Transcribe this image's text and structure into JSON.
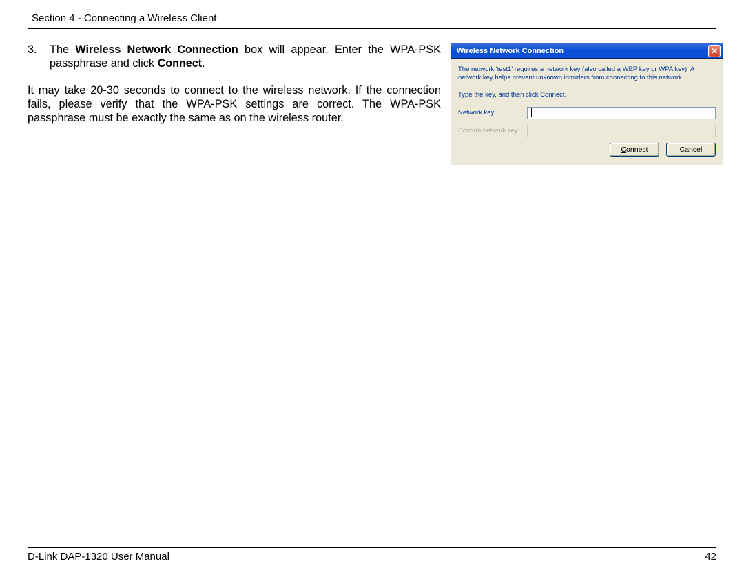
{
  "header": {
    "section": "Section 4 - Connecting a Wireless Client"
  },
  "step": {
    "num": "3.",
    "part1": "The ",
    "bold1": "Wireless Network Connection",
    "part2": " box will appear. Enter the WPA-PSK passphrase and click ",
    "bold2": "Connect",
    "part3": "."
  },
  "para2": "It may take 20-30 seconds to connect to the wireless network. If the connection fails, please verify that the WPA-PSK settings are correct. The WPA-PSK passphrase must be exactly the same as on the wireless router.",
  "dialog": {
    "title": "Wireless Network Connection",
    "intro": "The network 'test1' requires a network key (also called a WEP key or WPA key). A network key helps prevent unknown intruders from connecting to this network.",
    "instr": "Type the key, and then click Connect.",
    "label_key": "Network key:",
    "label_confirm": "Confirm network key:",
    "btn_connect_u": "C",
    "btn_connect_rest": "onnect",
    "btn_cancel": "Cancel"
  },
  "footer": {
    "left": "D-Link DAP-1320 User Manual",
    "right": "42"
  }
}
